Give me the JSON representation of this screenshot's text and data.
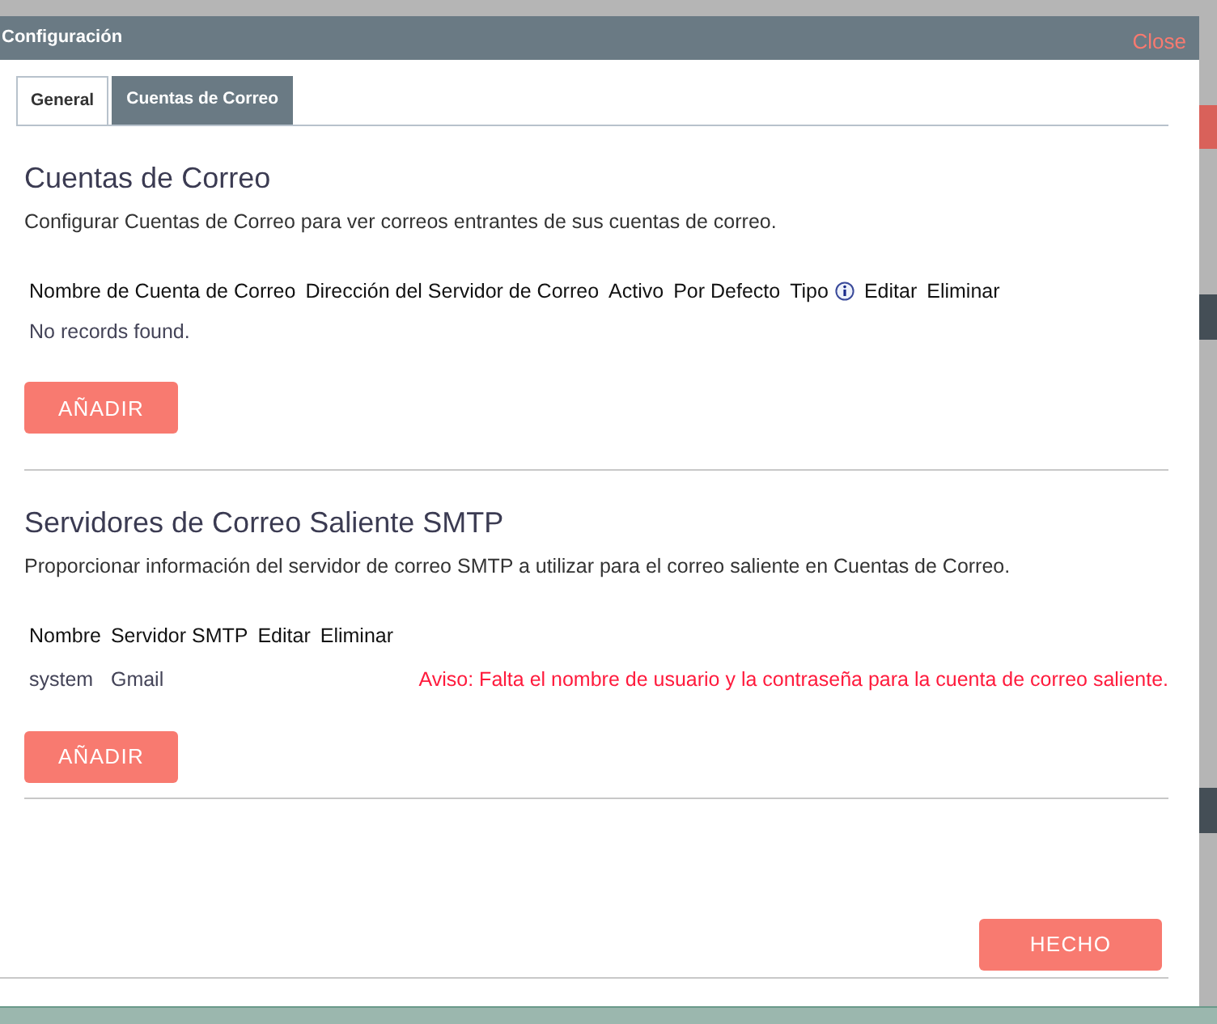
{
  "dialog": {
    "title": "Configuración",
    "close": "Close"
  },
  "tabs": [
    {
      "label": "General",
      "selected": false
    },
    {
      "label": "Cuentas de Correo",
      "selected": true
    }
  ],
  "sections": [
    {
      "heading": "Cuentas de Correo",
      "description": "Configurar Cuentas de Correo para ver correos entrantes de sus cuentas de correo.",
      "columns": [
        {
          "label": "Nombre de Cuenta de Correo",
          "kind": "plain"
        },
        {
          "label": "Dirección del Servidor de Correo",
          "kind": "plain"
        },
        {
          "label": "Activo",
          "kind": "plain"
        },
        {
          "label": "Por Defecto",
          "kind": "plain"
        },
        {
          "label": "Tipo",
          "kind": "info"
        },
        {
          "label": "Editar",
          "kind": "plain"
        },
        {
          "label": "Eliminar",
          "kind": "plain"
        }
      ],
      "empty_message": "No records found.",
      "add_button": "AÑADIR"
    },
    {
      "heading": "Servidores de Correo Saliente SMTP",
      "description": "Proporcionar información del servidor de correo SMTP a utilizar para el correo saliente en Cuentas de Correo.",
      "columns": [
        {
          "label": "Nombre",
          "kind": "plain"
        },
        {
          "label": "Servidor SMTP",
          "kind": "plain"
        },
        {
          "label": "Editar",
          "kind": "plain"
        },
        {
          "label": "Eliminar",
          "kind": "plain"
        }
      ],
      "rows": [
        {
          "cells": [
            "system",
            "Gmail"
          ],
          "warning": "Aviso: Falta el nombre de usuario y la contraseña para la cuenta de correo saliente."
        }
      ],
      "add_button": "AÑADIR"
    }
  ],
  "footer": {
    "done_button": "HECHO"
  }
}
